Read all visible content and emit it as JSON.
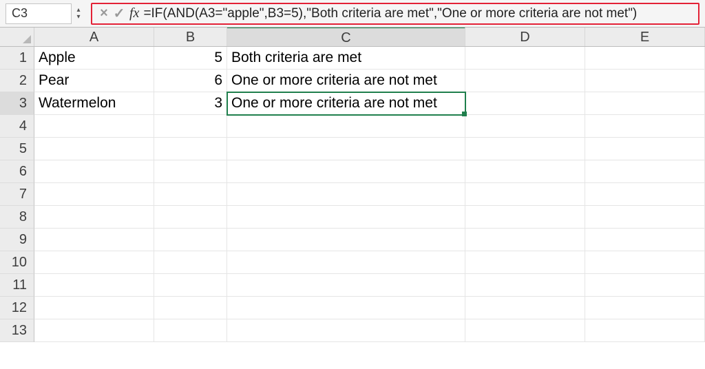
{
  "formula_bar": {
    "cell_ref": "C3",
    "cancel_icon": "×",
    "accept_icon": "✓",
    "fx_label": "fx",
    "formula": "=IF(AND(A3=\"apple\",B3=5),\"Both criteria are met\",\"One or more criteria are not met\")"
  },
  "columns": [
    "A",
    "B",
    "C",
    "D",
    "E"
  ],
  "rows": [
    "1",
    "2",
    "3",
    "4",
    "5",
    "6",
    "7",
    "8",
    "9",
    "10",
    "11",
    "12",
    "13"
  ],
  "active_cell": {
    "row": 3,
    "col": "C"
  },
  "cells": {
    "A1": "Apple",
    "B1": "5",
    "C1": "Both criteria are met",
    "A2": "Pear",
    "B2": "6",
    "C2": "One or more criteria are not met",
    "A3": "Watermelon",
    "B3": "3",
    "C3": "One or more criteria are not met"
  }
}
